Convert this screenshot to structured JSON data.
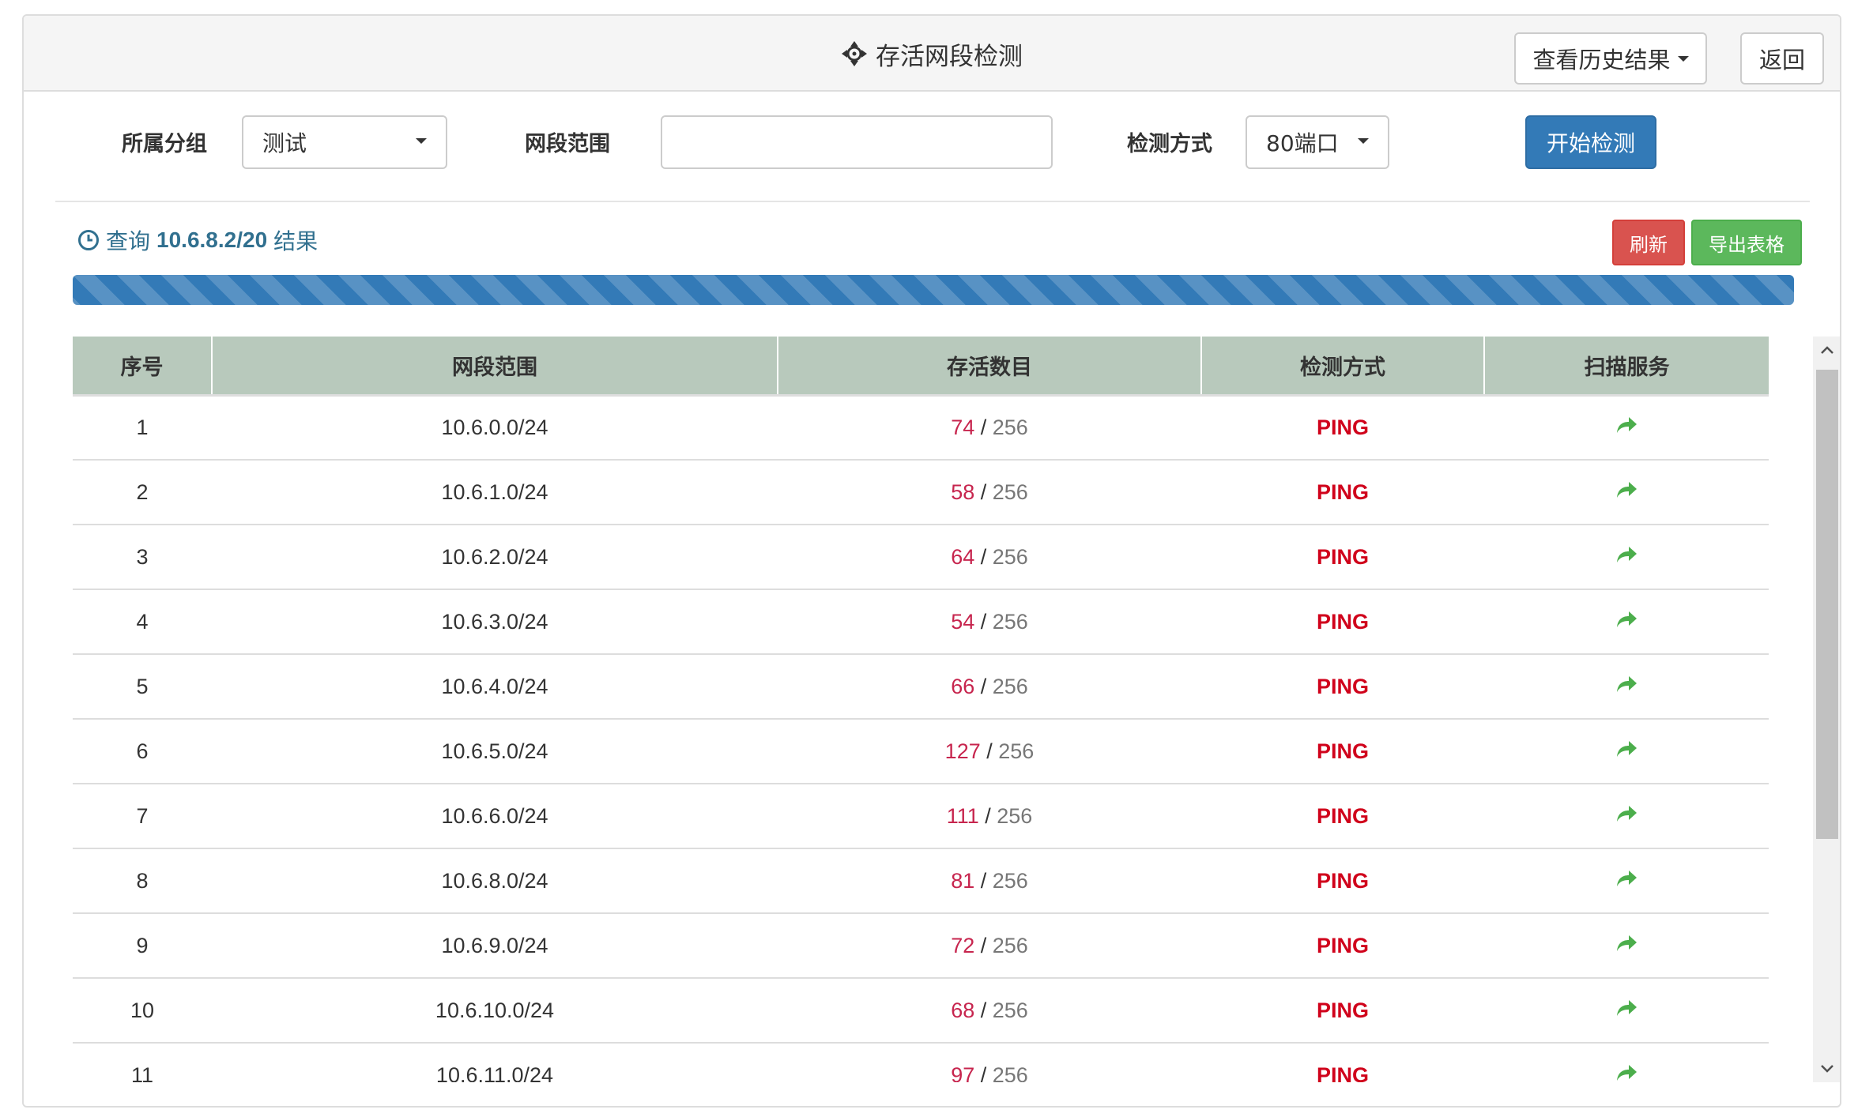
{
  "header": {
    "title": "存活网段检测",
    "history_button": "查看历史结果",
    "back_button": "返回"
  },
  "form": {
    "group_label": "所属分组",
    "group_value": "测试",
    "range_label": "网段范围",
    "range_value": "",
    "method_label": "检测方式",
    "method_value": "80端口",
    "start_button": "开始检测"
  },
  "result": {
    "query_prefix": "查询",
    "query_target": "10.6.8.2/20",
    "query_suffix": "结果",
    "refresh_button": "刷新",
    "export_button": "导出表格",
    "progress": 1.0
  },
  "table": {
    "columns": [
      "序号",
      "网段范围",
      "存活数目",
      "检测方式",
      "扫描服务"
    ],
    "rows": [
      {
        "index": "1",
        "range": "10.6.0.0/24",
        "alive": "74",
        "total": "256",
        "method": "PING"
      },
      {
        "index": "2",
        "range": "10.6.1.0/24",
        "alive": "58",
        "total": "256",
        "method": "PING"
      },
      {
        "index": "3",
        "range": "10.6.2.0/24",
        "alive": "64",
        "total": "256",
        "method": "PING"
      },
      {
        "index": "4",
        "range": "10.6.3.0/24",
        "alive": "54",
        "total": "256",
        "method": "PING"
      },
      {
        "index": "5",
        "range": "10.6.4.0/24",
        "alive": "66",
        "total": "256",
        "method": "PING"
      },
      {
        "index": "6",
        "range": "10.6.5.0/24",
        "alive": "127",
        "total": "256",
        "method": "PING"
      },
      {
        "index": "7",
        "range": "10.6.6.0/24",
        "alive": "111",
        "total": "256",
        "method": "PING"
      },
      {
        "index": "8",
        "range": "10.6.8.0/24",
        "alive": "81",
        "total": "256",
        "method": "PING"
      },
      {
        "index": "9",
        "range": "10.6.9.0/24",
        "alive": "72",
        "total": "256",
        "method": "PING"
      },
      {
        "index": "10",
        "range": "10.6.10.0/24",
        "alive": "68",
        "total": "256",
        "method": "PING"
      },
      {
        "index": "11",
        "range": "10.6.11.0/24",
        "alive": "97",
        "total": "256",
        "method": "PING"
      }
    ]
  },
  "colors": {
    "primary": "#337ab7",
    "danger": "#d9534f",
    "success": "#5cb85c",
    "table_header": "#b8c9bc",
    "alive_count": "#c7254e",
    "method_text": "#d0021b",
    "service_icon": "#4cae4c"
  },
  "icons": {
    "title": "crosshair-move-icon",
    "query": "clock-icon",
    "service": "share-arrow-icon",
    "scroll_up": "scroll-up-arrow-icon",
    "scroll_down": "scroll-down-arrow-icon"
  }
}
